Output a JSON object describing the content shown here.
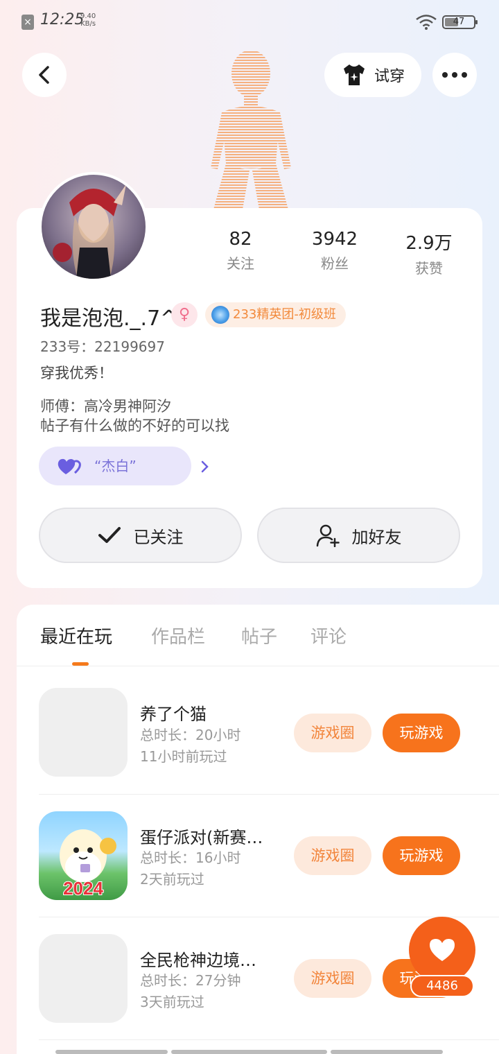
{
  "status_bar": {
    "time": "12:25",
    "net_speed_value": "9.40",
    "net_speed_unit": "KB/s",
    "battery": "47"
  },
  "header": {
    "try_on_label": "试穿"
  },
  "profile": {
    "stats": [
      {
        "value": "82",
        "label": "关注"
      },
      {
        "value": "3942",
        "label": "粉丝"
      },
      {
        "value": "2.9万",
        "label": "获赞"
      }
    ],
    "nickname": "我是泡泡._.7^",
    "gender_symbol": "♀",
    "club_badge": "233精英团-初级班",
    "uid": "233号：22199697",
    "bio": "穿我优秀！",
    "desc_line1": "师傅：高冷男神阿汐",
    "desc_line2": "帖子有什么做的不好的可以找",
    "title_chip": "“杰白”",
    "follow_label": "已关注",
    "add_friend_label": "加好友"
  },
  "tabs": [
    {
      "label": "最近在玩",
      "active": true
    },
    {
      "label": "作品栏",
      "active": false
    },
    {
      "label": "帖子",
      "active": false
    },
    {
      "label": "评论",
      "active": false
    }
  ],
  "games": [
    {
      "name": "养了个猫",
      "duration": "总时长：20小时",
      "last_played": "11小时前玩过",
      "circle_label": "游戏圈",
      "play_label": "玩游戏"
    },
    {
      "name": "蛋仔派对(新赛…",
      "duration": "总时长：16小时",
      "last_played": "2天前玩过",
      "circle_label": "游戏圈",
      "play_label": "玩游戏",
      "icon_text": "2024"
    },
    {
      "name": "全民枪神边境…",
      "duration": "总时长：27分钟",
      "last_played": "3天前玩过",
      "circle_label": "游戏圈",
      "play_label": "玩游戏"
    }
  ],
  "like": {
    "count": "4486"
  },
  "colors": {
    "accent": "#f7731c",
    "accent_light": "#fde9dc",
    "title_chip_bg": "#e9e6fb",
    "title_chip_text": "#7a72d8"
  }
}
